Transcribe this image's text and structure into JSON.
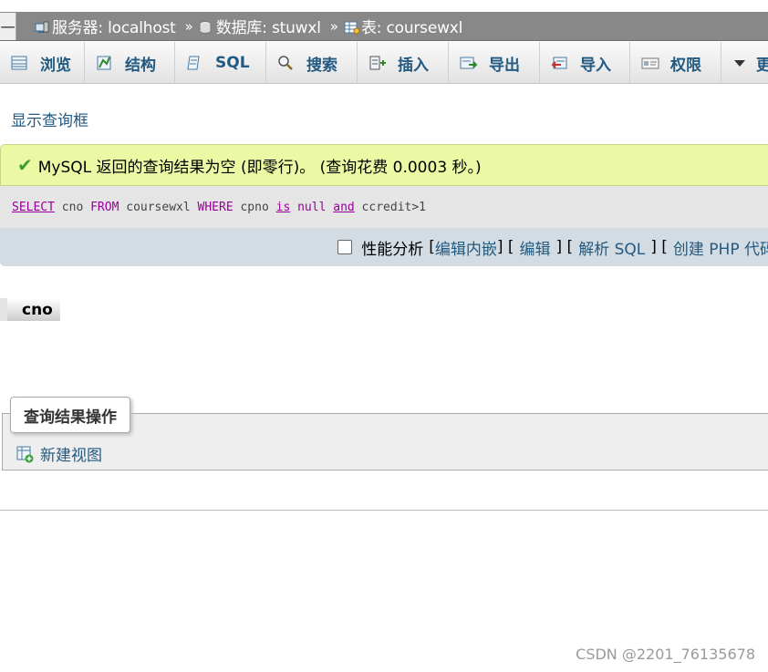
{
  "breadcrumb": {
    "left_cap": "一",
    "server_label": "服务器: localhost",
    "database_label": "数据库: stuwxl",
    "table_label": "表: coursewxl",
    "separator": "»"
  },
  "tabs": [
    {
      "label": "浏览",
      "icon": "browse-icon"
    },
    {
      "label": "结构",
      "icon": "structure-icon"
    },
    {
      "label": "SQL",
      "icon": "sql-icon"
    },
    {
      "label": "搜索",
      "icon": "search-icon"
    },
    {
      "label": "插入",
      "icon": "insert-icon"
    },
    {
      "label": "导出",
      "icon": "export-icon"
    },
    {
      "label": "导入",
      "icon": "import-icon"
    },
    {
      "label": "权限",
      "icon": "privileges-icon"
    },
    {
      "label": "更",
      "icon": "chevron-down-icon"
    }
  ],
  "show_query_link": "显示查询框",
  "result_message": "MySQL 返回的查询结果为空 (即零行)。 (查询花费 0.0003 秒。)",
  "sql": {
    "select": "SELECT",
    "col": " cno ",
    "from": "FROM",
    "table": " coursewxl ",
    "where": "WHERE",
    "field": " cpno ",
    "is": "is",
    "nullv": " null ",
    "and": "and",
    "cond": " ccredit>1"
  },
  "tools": {
    "profiling_label": "性能分析",
    "bracket_open": "[",
    "edit_inline": "编辑内嵌",
    "sep1": "] [",
    "edit": "编辑",
    "sep2": "] [",
    "explain": "解析 SQL",
    "sep3": "] [",
    "create_php": "创建 PHP 代码"
  },
  "result_table": {
    "columns": [
      "cno"
    ]
  },
  "query_ops": {
    "legend": "查询结果操作",
    "new_view": "新建视图"
  },
  "watermark": "CSDN @2201_76135678"
}
